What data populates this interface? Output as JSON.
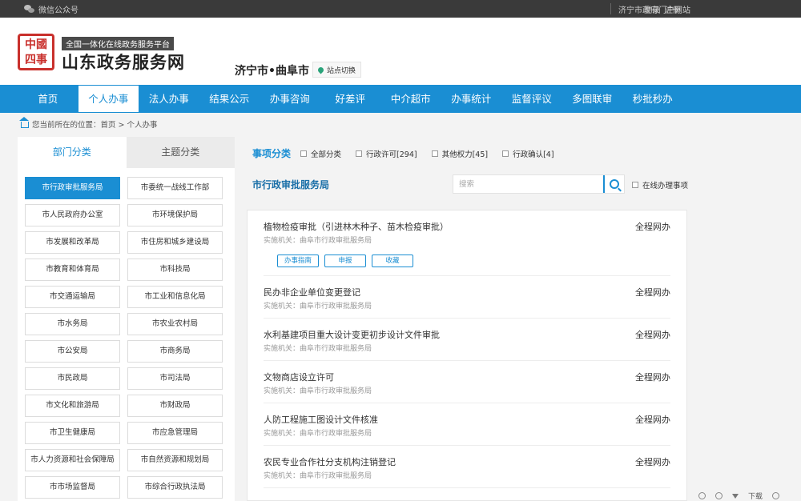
{
  "topbar": {
    "wechat": "微信公众号",
    "login": "登录",
    "register": "注册",
    "portal": "济宁市政府门户网站"
  },
  "header": {
    "seal_lines": [
      "中",
      "國",
      "四",
      "事"
    ],
    "slogan": "全国一体化在线政务服务平台",
    "site_name": "山东政务服务网",
    "city": "济宁市•曲阜市",
    "switch_label": "站点切换"
  },
  "nav": [
    "首页",
    "个人办事",
    "法人办事",
    "结果公示",
    "办事咨询",
    "好差评",
    "中介超市",
    "办事统计",
    "监督评议",
    "多图联审",
    "秒批秒办"
  ],
  "nav_active": 1,
  "breadcrumb": "您当前所在的位置：首页 > 个人办事",
  "left": {
    "tabs": [
      "部门分类",
      "主题分类"
    ],
    "departments": [
      "市行政审批服务局",
      "市委统一战线工作部",
      "市人民政府办公室",
      "市环境保护局",
      "市发展和改革局",
      "市住房和城乡建设局",
      "市教育和体育局",
      "市科技局",
      "市交通运输局",
      "市工业和信息化局",
      "市水务局",
      "市农业农村局",
      "市公安局",
      "市商务局",
      "市民政局",
      "市司法局",
      "市文化和旅游局",
      "市财政局",
      "市卫生健康局",
      "市应急管理局",
      "市人力资源和社会保障局",
      "市自然资源和规划局",
      "市市场监督局",
      "市综合行政执法局"
    ]
  },
  "filter": {
    "title": "事项分类",
    "options": [
      "全部分类",
      "行政许可[294]",
      "其他权力[45]",
      "行政确认[4]"
    ]
  },
  "dept_title": "市行政审批服务局",
  "search": {
    "placeholder": "搜索",
    "online_label": "在线办理事项"
  },
  "items": [
    {
      "title": "植物检疫审批（引进林木种子、苗木检疫审批）",
      "org": "实施机关：曲阜市行政审批服务局",
      "mode": "全程网办",
      "actions": [
        "办事指南",
        "申报",
        "收藏"
      ]
    },
    {
      "title": "民办非企业单位变更登记",
      "org": "实施机关：曲阜市行政审批服务局",
      "mode": "全程网办"
    },
    {
      "title": "水利基建项目重大设计变更初步设计文件审批",
      "org": "实施机关：曲阜市行政审批服务局",
      "mode": "全程网办"
    },
    {
      "title": "文物商店设立许可",
      "org": "实施机关：曲阜市行政审批服务局",
      "mode": "全程网办"
    },
    {
      "title": "人防工程施工图设计文件核准",
      "org": "实施机关：曲阜市行政审批服务局",
      "mode": "全程网办"
    },
    {
      "title": "农民专业合作社分支机构注销登记",
      "org": "实施机关：曲阜市行政审批服务局",
      "mode": "全程网办"
    }
  ],
  "tools": {
    "download": "下载"
  }
}
